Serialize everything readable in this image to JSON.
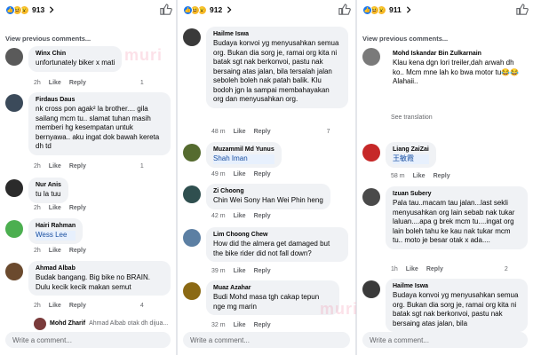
{
  "col1": {
    "react_count": "913",
    "prev_label": "View previous comments...",
    "comments": [
      {
        "name": "Winx Chin",
        "text": "unfortunately biker x mati",
        "time": "2h",
        "badge": "1"
      },
      {
        "name": "Firdaus Daus",
        "text": "nk cross pon agak² la brother.... gila sailang mcm tu.. slamat tuhan masih memberi hg kesempatan untuk bernyawa.. aku ingat dok bawah kereta dh td",
        "time": "2h",
        "badge": "1"
      },
      {
        "name": "Nur Anis",
        "text": "tu la tuu",
        "time": "2h",
        "badge": ""
      },
      {
        "name": "Hairi Rahman",
        "text": "Wess Lee",
        "time": "2h",
        "badge": ""
      },
      {
        "name": "Ahmad Albab",
        "text": "Budak bangang. Big bike no BRAIN. Dulu kecik kecik makan semut",
        "time": "2h",
        "badge": "4"
      }
    ],
    "reply_preview": {
      "name": "Mohd Zharif",
      "text": "Ahmad Albab otak dh dijua..."
    },
    "write_placeholder": "Write a comment..."
  },
  "col2": {
    "react_count": "912",
    "comments": [
      {
        "name": "Hailme Iswa",
        "text": "Budaya konvoi yg menyusahkan semua org. Bukan dia sorg je, ramai org kita ni batak sgt nak berkonvoi, pastu nak bersaing atas jalan, bila tersalah jalan seboleh boleh nak patah balik. Klu bodoh jgn la sampai membahayakan org dan menyusahkan org.",
        "time": "48 m",
        "badge": "7"
      },
      {
        "name": "Muzammil Md Yunus",
        "text": "Shah Iman",
        "time": "49 m",
        "badge": ""
      },
      {
        "name": "Zi Choong",
        "text": "Chin Wei Sony Han Wei Phin heng",
        "time": "42 m",
        "badge": ""
      },
      {
        "name": "Lim Choong Chew",
        "text": "How did the almera get damaged but the bike rider did not fall down?",
        "time": "39 m",
        "badge": ""
      },
      {
        "name": "Muaz Azahar",
        "text": "Budi Mohd masa tgh cakap tepun nge mg marin",
        "time": "32 m",
        "badge": ""
      }
    ],
    "write_placeholder": "Write a comment..."
  },
  "col3": {
    "react_count": "911",
    "prev_label": "View previous comments...",
    "comments": [
      {
        "name": "Mohd Iskandar Bin Zulkarnain",
        "text": "Klau kena dgn lori treiler,dah arwah dh ko.. Mcm mne lah ko bwa motor tu😂😂 Alahaii..",
        "time": "",
        "badge": ""
      },
      {
        "name": "Liang ZaiZai",
        "text": "王敏霞",
        "time": "58 m",
        "badge": ""
      },
      {
        "name": "Izuan Subery",
        "text": "Pala tau..macam tau jalan...last sekli menyusahkan org lain sebab nak tukar laluan....apa g brek mcm tu....ingat org lain boleh tahu ke kau nak tukar mcm tu.. moto je besar otak x ada....",
        "time": "1h",
        "badge": "2"
      },
      {
        "name": "Hailme Iswa",
        "text": "Budaya konvoi yg menyusahkan semua org. Bukan dia sorg je, ramai org kita ni batak sgt nak berkonvoi, pastu nak bersaing atas jalan, bila",
        "time": "",
        "badge": ""
      }
    ],
    "see_translation": "See translation",
    "write_placeholder": "Write a comment..."
  },
  "labels": {
    "like": "Like",
    "reply": "Reply"
  },
  "watermark": "muri"
}
